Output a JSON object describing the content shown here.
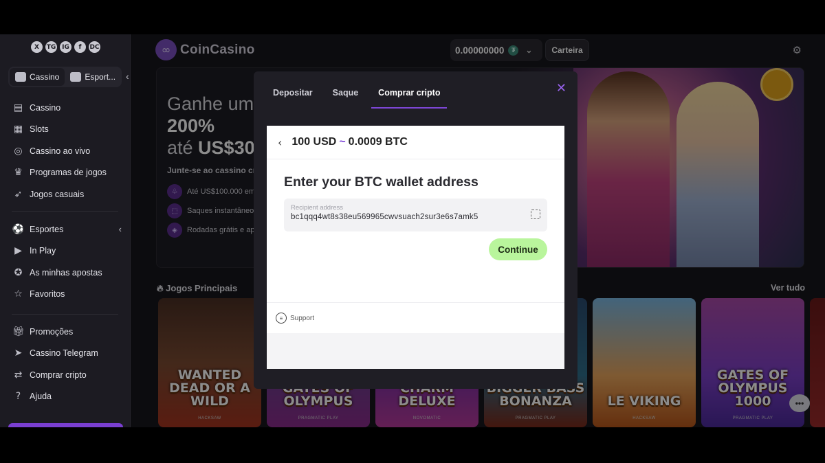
{
  "sidebar": {
    "social": [
      "X",
      "TG",
      "IG",
      "f",
      "DC"
    ],
    "mode_tabs": [
      {
        "label": "Cassino"
      },
      {
        "label": "Esport..."
      }
    ],
    "group1": [
      {
        "label": "Cassino",
        "icon": "cards-icon"
      },
      {
        "label": "Slots",
        "icon": "slot-machine-icon"
      },
      {
        "label": "Cassino ao vivo",
        "icon": "live-casino-icon"
      },
      {
        "label": "Programas de jogos",
        "icon": "game-show-icon"
      },
      {
        "label": "Jogos casuais",
        "icon": "rocket-icon"
      }
    ],
    "group2": [
      {
        "label": "Esportes",
        "icon": "sports-icon"
      },
      {
        "label": "In Play",
        "icon": "play-icon"
      },
      {
        "label": "As minhas apostas",
        "icon": "bets-icon"
      },
      {
        "label": "Favoritos",
        "icon": "star-icon"
      }
    ],
    "group3": [
      {
        "label": "Promoções",
        "icon": "gift-icon"
      },
      {
        "label": "Cassino Telegram",
        "icon": "telegram-icon"
      },
      {
        "label": "Comprar cripto",
        "icon": "buy-crypto-icon"
      },
      {
        "label": "Ajuda",
        "icon": "help-icon"
      }
    ]
  },
  "header": {
    "logo_text": "CoinCasino",
    "balance": "0.00000000",
    "wallet_label": "Carteira"
  },
  "hero": {
    "line1": "Ganhe um",
    "line2": "200%",
    "line3_prefix": "até ",
    "line3_bold": "US$30",
    "subtitle": "Junte-se ao cassino crip",
    "perks": [
      "Até US$100.000 em",
      "Saques instantâneos",
      "Rodadas grátis e apo"
    ]
  },
  "games": {
    "title": "Jogos Principais",
    "view_all": "Ver tudo",
    "cards": [
      {
        "name": "WANTED DEAD OR A WILD",
        "provider": "HACKSAW"
      },
      {
        "name": "GATES OF OLYMPUS",
        "provider": "PRAGMATIC PLAY"
      },
      {
        "name": "LUCKY LADY'S CHARM DELUXE",
        "provider": "NOVOMATIC"
      },
      {
        "name": "BIGGER BASS BONANZA",
        "provider": "PRAGMATIC PLAY"
      },
      {
        "name": "LE VIKING",
        "provider": "HACKSAW"
      },
      {
        "name": "GATES OF OLYMPUS 1000",
        "provider": "PRAGMATIC PLAY"
      }
    ]
  },
  "modal": {
    "tabs": [
      "Depositar",
      "Saque",
      "Comprar cripto"
    ],
    "active_tab": 2,
    "close_symbol": "✕",
    "widget": {
      "amount_fiat": "100 USD",
      "approx": "~",
      "amount_crypto": "0.0009 BTC",
      "title": "Enter your BTC wallet address",
      "field_label": "Recipient address",
      "field_value": "bc1qqq4wt8s38eu569965cwvsuach2sur3e6s7amk5",
      "continue_label": "Continue",
      "support_label": "Support"
    }
  },
  "colors": {
    "accent": "#7d46d6",
    "continue_bg": "#b9f59c"
  }
}
